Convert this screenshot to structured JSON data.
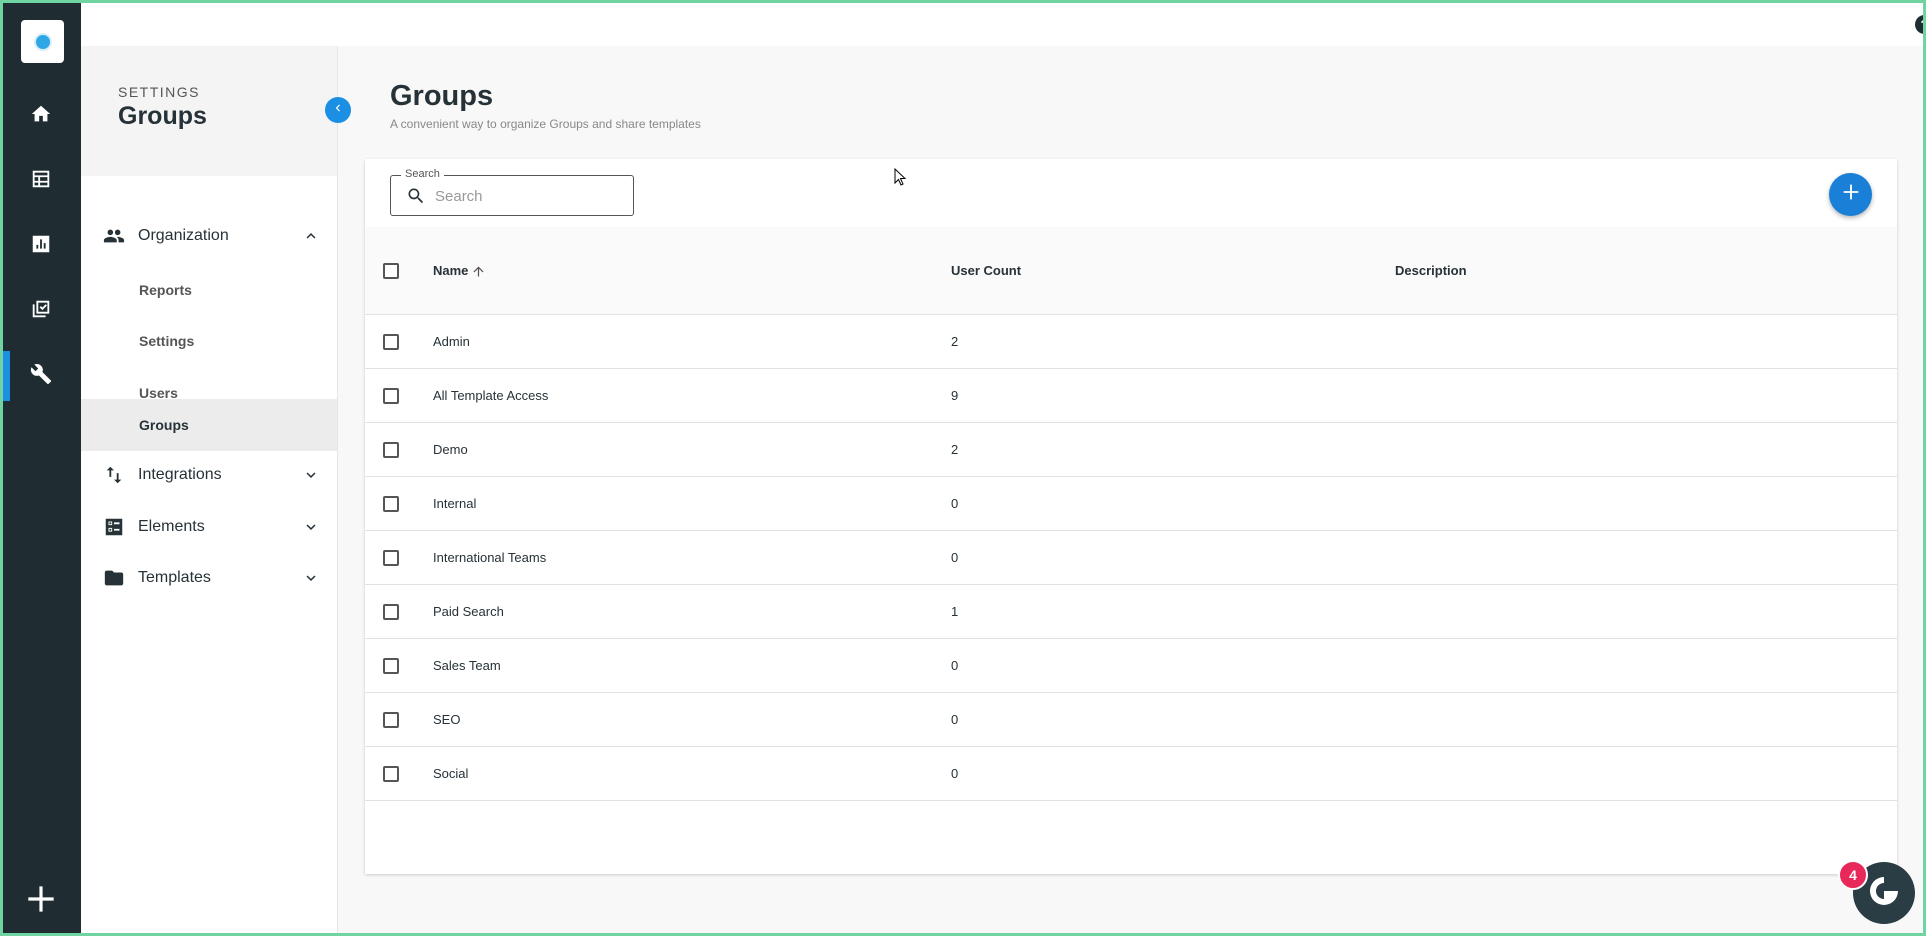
{
  "rail": {
    "items": [
      {
        "icon": "home-icon"
      },
      {
        "icon": "table-icon"
      },
      {
        "icon": "chart-icon"
      },
      {
        "icon": "checklist-icon"
      },
      {
        "icon": "wrench-icon",
        "active": true
      }
    ],
    "add_icon": "plus-icon"
  },
  "topbar": {
    "help_glyph": "?",
    "avatar_icon": "avatar"
  },
  "sidebar": {
    "kicker": "SETTINGS",
    "heading": "Groups",
    "sections": [
      {
        "label": "Organization",
        "icon": "people-icon",
        "expanded": true
      },
      {
        "label": "Integrations",
        "icon": "sync-arrows-icon",
        "expanded": false
      },
      {
        "label": "Elements",
        "icon": "elements-icon",
        "expanded": false
      },
      {
        "label": "Templates",
        "icon": "folder-icon",
        "expanded": false
      }
    ],
    "organization_items": [
      {
        "label": "Reports"
      },
      {
        "label": "Settings"
      },
      {
        "label": "Users"
      },
      {
        "label": "Groups",
        "active": true
      }
    ]
  },
  "main": {
    "title": "Groups",
    "subtitle": "A convenient way to organize Groups and share templates",
    "search": {
      "legend": "Search",
      "placeholder": "Search",
      "value": ""
    },
    "table": {
      "columns": {
        "name": "Name",
        "user_count": "User Count",
        "description": "Description"
      },
      "sort": {
        "column": "Name",
        "direction": "ascending"
      },
      "rows": [
        {
          "name": "Admin",
          "user_count": "2",
          "description": ""
        },
        {
          "name": "All Template Access",
          "user_count": "9",
          "description": ""
        },
        {
          "name": "Demo",
          "user_count": "2",
          "description": ""
        },
        {
          "name": "Internal",
          "user_count": "0",
          "description": ""
        },
        {
          "name": "International Teams",
          "user_count": "0",
          "description": ""
        },
        {
          "name": "Paid Search",
          "user_count": "1",
          "description": ""
        },
        {
          "name": "Sales Team",
          "user_count": "0",
          "description": ""
        },
        {
          "name": "SEO",
          "user_count": "0",
          "description": ""
        },
        {
          "name": "Social",
          "user_count": "0",
          "description": ""
        }
      ]
    }
  },
  "widget": {
    "badge_count": "4"
  },
  "colors": {
    "accent": "#1a8fe3",
    "rail": "#1f2d33",
    "badge": "#e8275b"
  }
}
